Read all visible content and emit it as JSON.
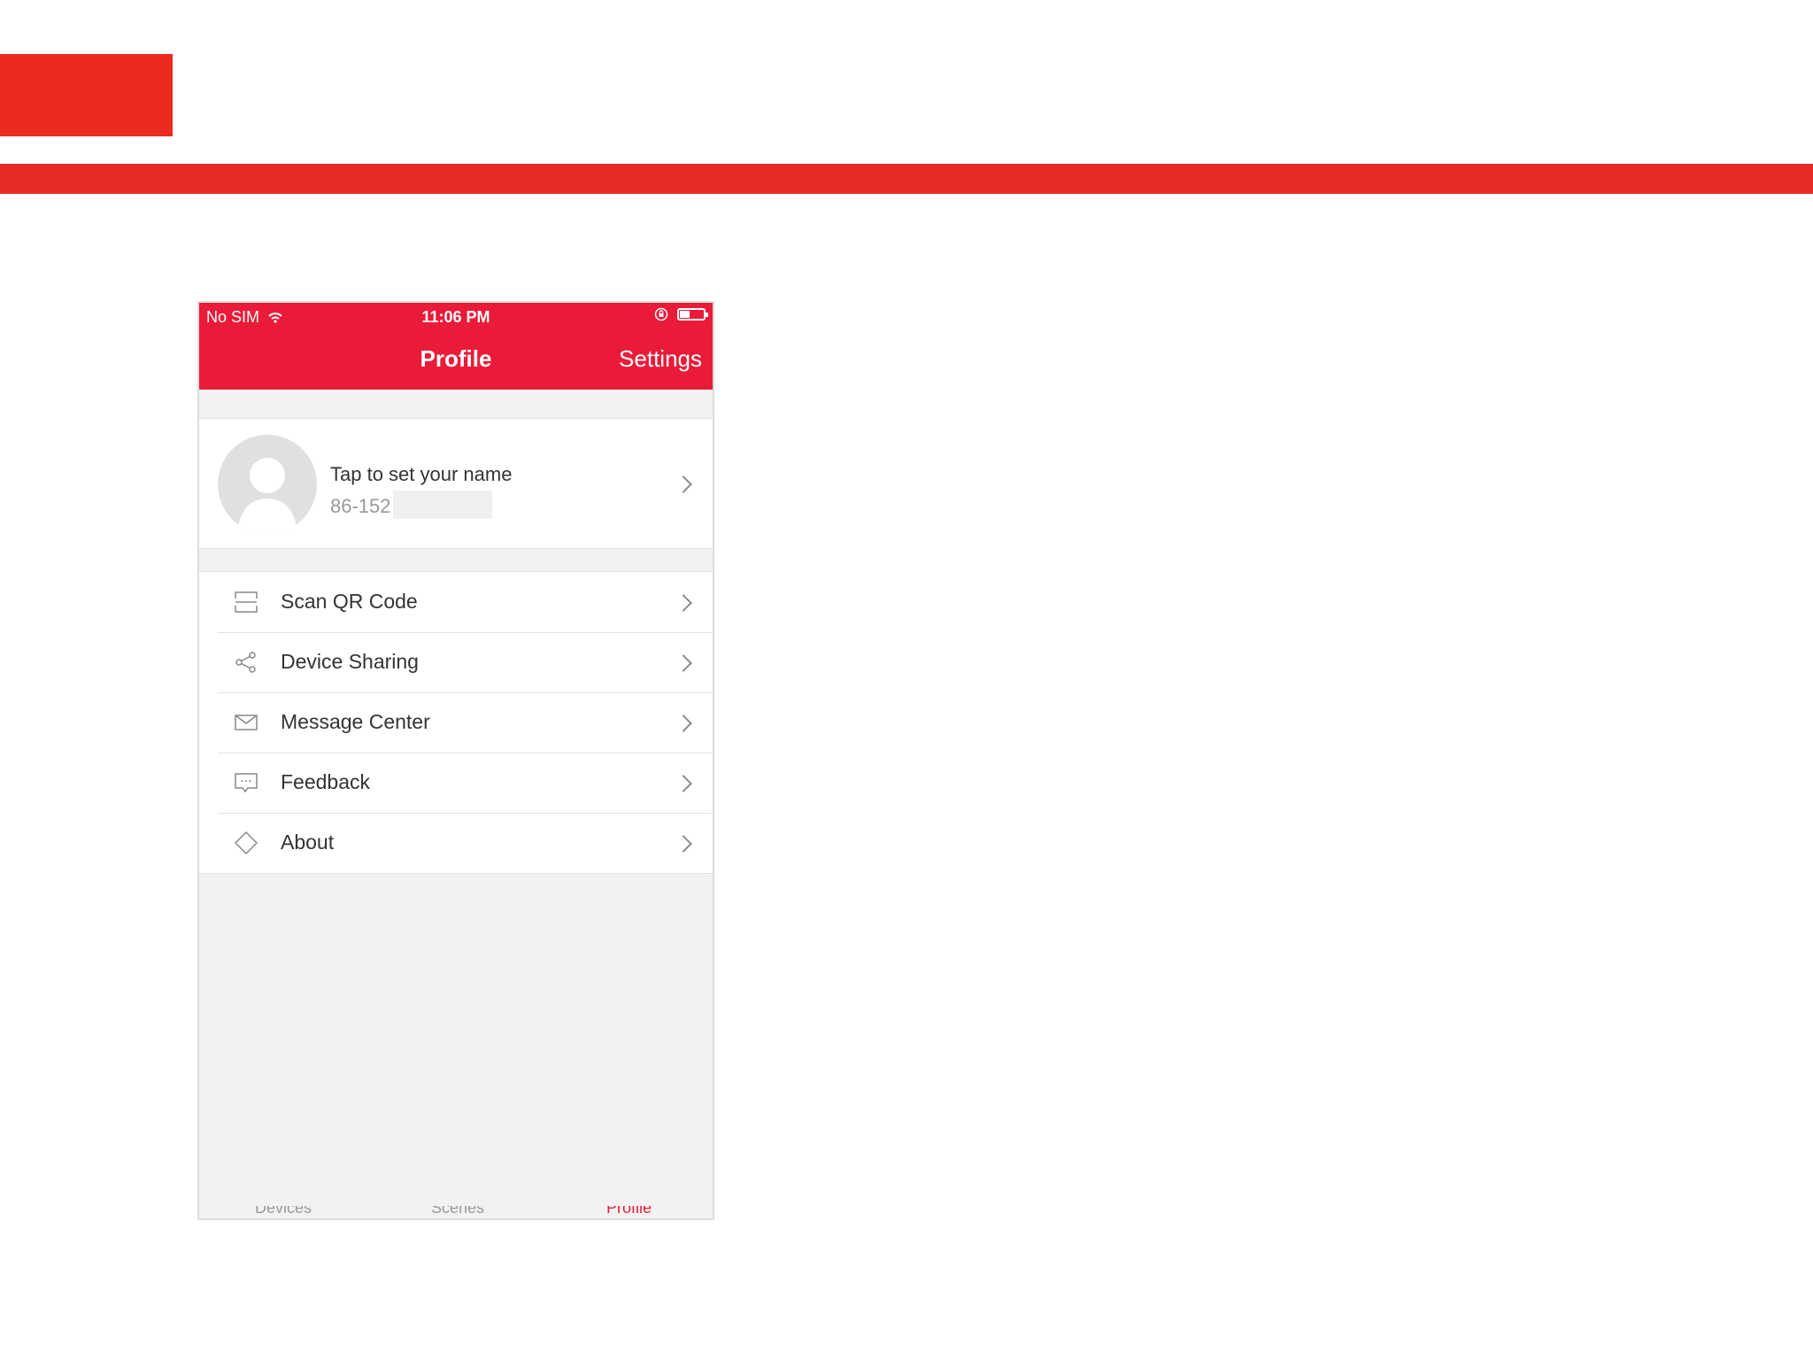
{
  "phone": {
    "status_bar": {
      "carrier": "No SIM",
      "time": "11:06 PM"
    },
    "nav": {
      "title": "Profile",
      "settings_label": "Settings"
    },
    "profile": {
      "name_prompt": "Tap to set your name",
      "phone_prefix": "86-152"
    },
    "menu": [
      {
        "label": "Scan QR Code",
        "icon": "scan-icon"
      },
      {
        "label": "Device Sharing",
        "icon": "share-icon"
      },
      {
        "label": "Message Center",
        "icon": "mail-icon"
      },
      {
        "label": "Feedback",
        "icon": "feedback-icon"
      },
      {
        "label": "About",
        "icon": "about-icon"
      }
    ],
    "tabs": [
      "Devices",
      "Scenes",
      "Profile"
    ]
  },
  "colors": {
    "brand_red": "#ea1b38",
    "slide_red": "#ec2b1f",
    "background": "#f2f2f2"
  }
}
